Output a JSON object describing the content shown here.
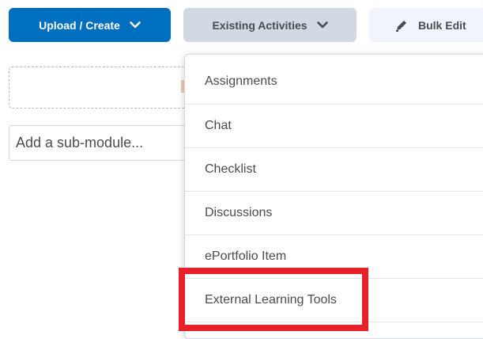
{
  "toolbar": {
    "upload_create_label": "Upload / Create",
    "existing_activities_label": "Existing Activities",
    "bulk_edit_label": "Bulk Edit",
    "icons": {
      "upload_create": "chevron-down-icon",
      "existing_activities": "chevron-down-icon",
      "bulk_edit": "pencil-icon"
    }
  },
  "dropzone": {
    "visible_text_fragment": "po"
  },
  "submodule": {
    "placeholder": "Add a sub-module..."
  },
  "menu": {
    "items": [
      {
        "label": "Assignments"
      },
      {
        "label": "Chat"
      },
      {
        "label": "Checklist"
      },
      {
        "label": "Discussions"
      },
      {
        "label": "ePortfolio Item"
      },
      {
        "label": "External Learning Tools"
      }
    ]
  },
  "colors": {
    "primary_button": "#006fbf",
    "secondary_button": "#d3d9e3",
    "tertiary_button": "#f1f5fb",
    "text": "#494c4e",
    "highlight_box": "#e8202a"
  }
}
